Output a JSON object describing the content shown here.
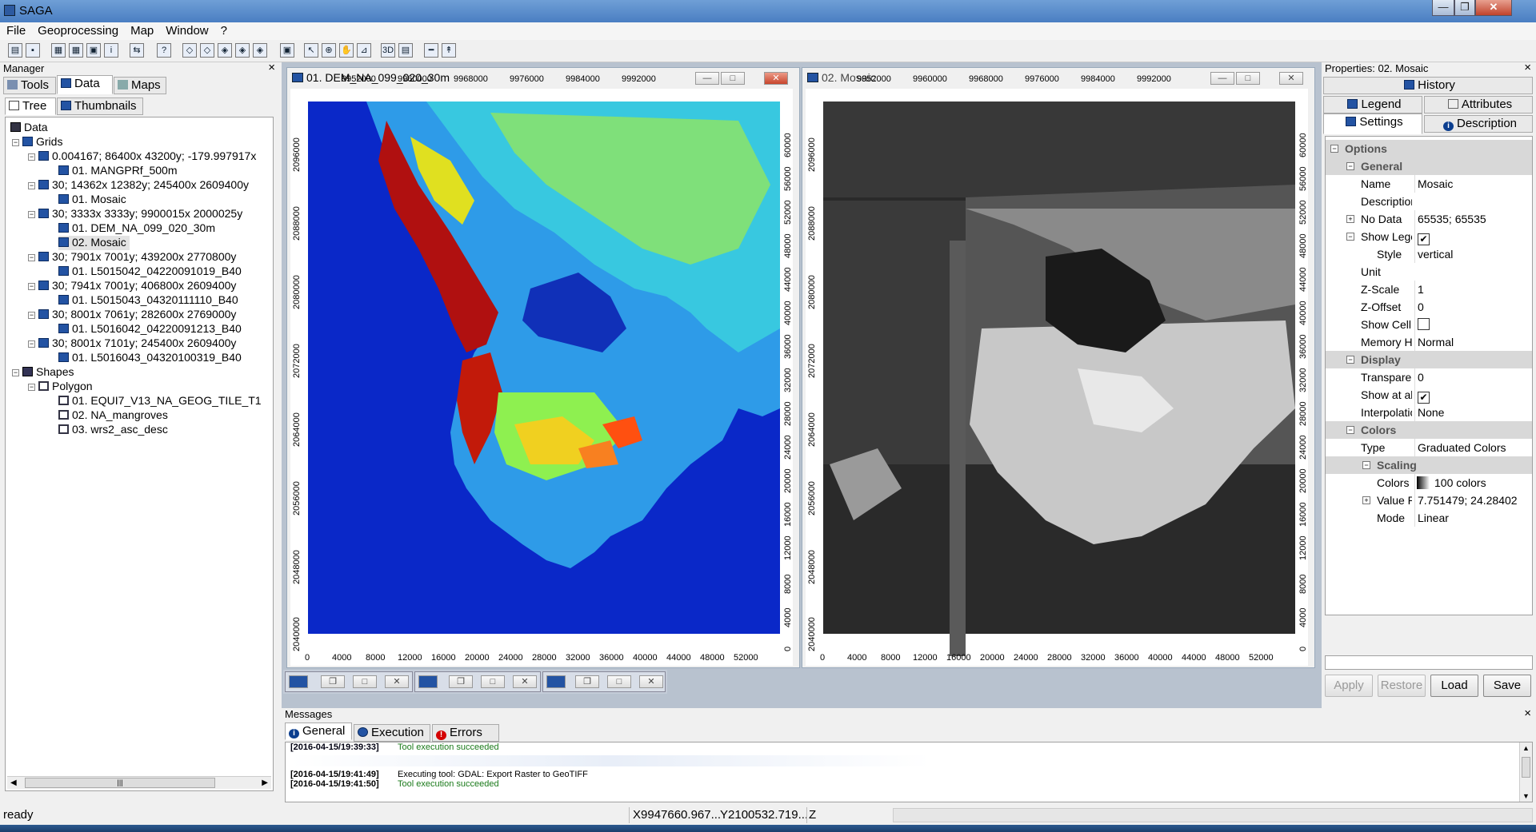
{
  "app": {
    "title": "SAGA"
  },
  "window_controls": {
    "minimize": "—",
    "restore": "❐",
    "close": "✕"
  },
  "menu": [
    "File",
    "Geoprocessing",
    "Map",
    "Window",
    "?"
  ],
  "manager": {
    "title": "Manager",
    "close": "×",
    "tabs": {
      "tools": "Tools",
      "data": "Data",
      "maps": "Maps"
    },
    "subtabs": {
      "tree": "Tree",
      "thumbnails": "Thumbnails"
    },
    "tree": {
      "root": "Data",
      "grids": "Grids",
      "g1": "0.004167; 86400x 43200y; -179.997917x",
      "g1a": "01. MANGPRf_500m",
      "g2": "30; 14362x 12382y; 245400x 2609400y",
      "g2a": "01. Mosaic",
      "g3": "30; 3333x 3333y; 9900015x 2000025y",
      "g3a": "01. DEM_NA_099_020_30m",
      "g3b": "02. Mosaic",
      "g4": "30; 7901x 7001y; 439200x 2770800y",
      "g4a": "01. L5015042_04220091019_B40",
      "g5": "30; 7941x 7001y; 406800x 2609400y",
      "g5a": "01. L5015043_04320111110_B40",
      "g6": "30; 8001x 7061y; 282600x 2769000y",
      "g6a": "01. L5016042_04220091213_B40",
      "g7": "30; 8001x 7101y; 245400x 2609400y",
      "g7a": "01. L5016043_04320100319_B40",
      "shapes": "Shapes",
      "polygon": "Polygon",
      "s1": "01. EQUI7_V13_NA_GEOG_TILE_T1",
      "s2": "02. NA_mangroves",
      "s3": "03. wrs2_asc_desc"
    },
    "scroll_grip": "|||"
  },
  "map1": {
    "title": "01. DEM_NA_099_020_30m",
    "top_ticks": [
      "9952000",
      "9960000",
      "9968000",
      "9976000",
      "9984000",
      "9992000"
    ],
    "bottom_ticks": [
      "0",
      "4000",
      "8000",
      "12000",
      "16000",
      "20000",
      "24000",
      "28000",
      "32000",
      "36000",
      "40000",
      "44000",
      "48000",
      "52000"
    ],
    "left_ticks": [
      "2096000",
      "2088000",
      "2080000",
      "2072000",
      "2064000",
      "2056000",
      "2048000",
      "2040000"
    ],
    "right_ticks": [
      "60000",
      "56000",
      "52000",
      "48000",
      "44000",
      "40000",
      "36000",
      "32000",
      "28000",
      "24000",
      "20000",
      "16000",
      "12000",
      "8000",
      "4000",
      "0"
    ]
  },
  "map2": {
    "title": "02. Mosaic",
    "top_ticks": [
      "9952000",
      "9960000",
      "9968000",
      "9976000",
      "9984000",
      "9992000"
    ],
    "bottom_ticks": [
      "0",
      "4000",
      "8000",
      "12000",
      "16000",
      "20000",
      "24000",
      "28000",
      "32000",
      "36000",
      "40000",
      "44000",
      "48000",
      "52000"
    ],
    "left_ticks": [
      "2096000",
      "2088000",
      "2080000",
      "2072000",
      "2064000",
      "2056000",
      "2048000",
      "2040000"
    ],
    "right_ticks": [
      "60000",
      "56000",
      "52000",
      "48000",
      "44000",
      "40000",
      "36000",
      "32000",
      "28000",
      "24000",
      "20000",
      "16000",
      "12000",
      "8000",
      "4000",
      "0"
    ]
  },
  "properties": {
    "title": "Properties: 02. Mosaic",
    "close": "×",
    "tabs": {
      "history": "History",
      "legend": "Legend",
      "attributes": "Attributes",
      "settings": "Settings",
      "description": "Description"
    },
    "rows": {
      "options": "Options",
      "general": "General",
      "name_k": "Name",
      "name_v": "Mosaic",
      "desc_k": "Description",
      "desc_v": "",
      "nodata_k": "No Data",
      "nodata_v": "65535; 65535",
      "showleg_k": "Show Leger",
      "style_k": "Style",
      "style_v": "vertical",
      "unit_k": "Unit",
      "unit_v": "",
      "zscale_k": "Z-Scale",
      "zscale_v": "1",
      "zoffset_k": "Z-Offset",
      "zoffset_v": "0",
      "showcell_k": "Show Cell V",
      "memory_k": "Memory Ha",
      "memory_v": "Normal",
      "display": "Display",
      "transp_k": "Transparenc",
      "transp_v": "0",
      "showall_k": "Show at all",
      "interp_k": "Interpolatio",
      "interp_v": "None",
      "colors": "Colors",
      "type_k": "Type",
      "type_v": "Graduated Colors",
      "scaling": "Scaling",
      "colors_k": "Colors",
      "colors_v": "100 colors",
      "valuer_k": "Value Ra",
      "valuer_v": "7.751479; 24.28402",
      "mode_k": "Mode",
      "mode_v": "Linear"
    },
    "buttons": {
      "apply": "Apply",
      "restore": "Restore",
      "load": "Load",
      "save": "Save"
    }
  },
  "messages": {
    "title": "Messages",
    "close": "×",
    "tabs": {
      "general": "General",
      "execution": "Execution",
      "errors": "Errors"
    },
    "lines": [
      {
        "ts": "[2016-04-15/19:39:33]",
        "text": "Tool execution succeeded"
      },
      {
        "ts": "[2016-04-15/19:41:49]",
        "text": "Executing tool: GDAL: Export Raster to GeoTIFF"
      },
      {
        "ts": "[2016-04-15/19:41:50]",
        "text": "Tool execution succeeded"
      }
    ]
  },
  "status": {
    "text": "ready",
    "x": "X9947660.967...",
    "y": "Y2100532.719...",
    "z": "Z"
  }
}
